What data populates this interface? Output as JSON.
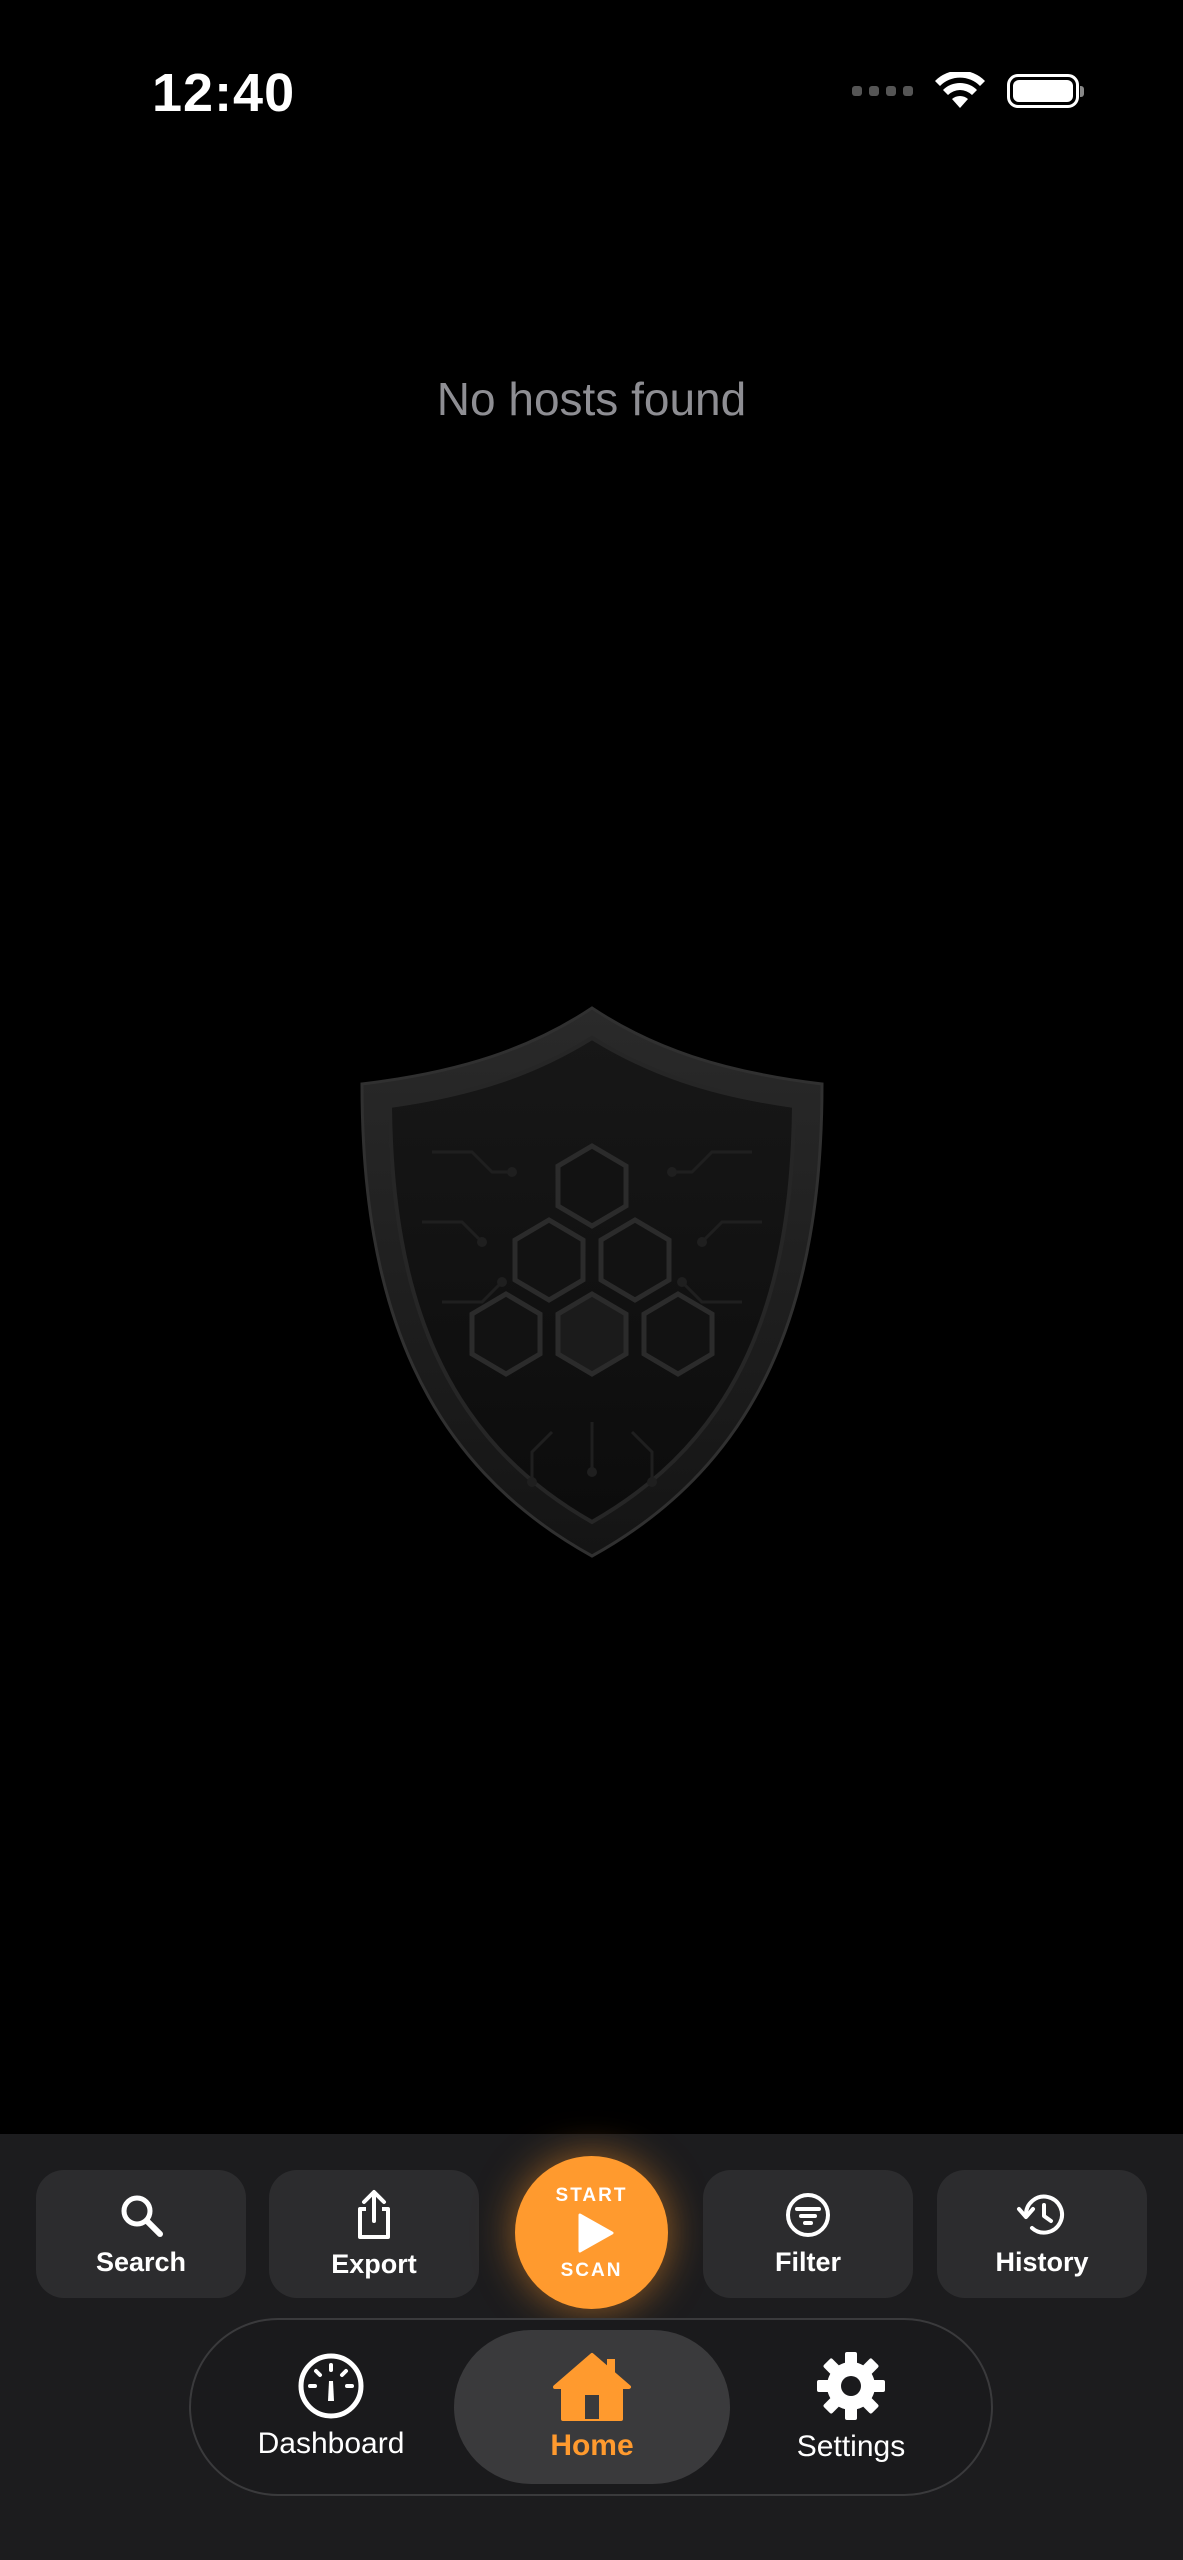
{
  "status_bar": {
    "time": "12:40",
    "icons": [
      "cellular-dots-icon",
      "wifi-icon",
      "battery-icon"
    ]
  },
  "main": {
    "empty_message": "No hosts found",
    "illustration": "shield-hexagon-icon"
  },
  "actions": [
    {
      "label": "Search",
      "icon": "search-icon"
    },
    {
      "label": "Export",
      "icon": "share-icon"
    },
    {
      "label": "Filter",
      "icon": "filter-icon"
    },
    {
      "label": "History",
      "icon": "history-icon"
    }
  ],
  "scan_button": {
    "top_label": "START",
    "bottom_label": "SCAN",
    "icon": "play-icon"
  },
  "tabs": [
    {
      "label": "Dashboard",
      "icon": "gauge-icon",
      "active": false
    },
    {
      "label": "Home",
      "icon": "house-icon",
      "active": true
    },
    {
      "label": "Settings",
      "icon": "gear-icon",
      "active": false
    }
  ],
  "colors": {
    "accent": "#ff9a2e",
    "background": "#000000",
    "panel": "#1c1c1e",
    "button": "#2c2c2e",
    "muted_text": "#8e8e93"
  }
}
